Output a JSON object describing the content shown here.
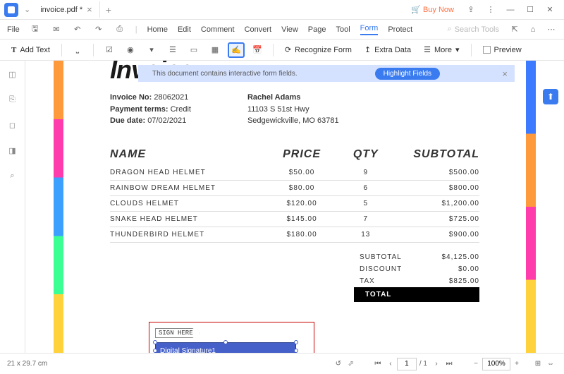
{
  "titlebar": {
    "tab_filename": "invoice.pdf *",
    "buy_now": "Buy Now"
  },
  "menubar": {
    "file": "File",
    "items": [
      "Home",
      "Edit",
      "Comment",
      "Convert",
      "View",
      "Page",
      "Tool",
      "Form",
      "Protect"
    ],
    "search_placeholder": "Search Tools"
  },
  "toolbar": {
    "add_text": "Add Text",
    "recognize_form": "Recognize Form",
    "extra_data": "Extra Data",
    "more": "More",
    "preview": "Preview"
  },
  "banner": {
    "message": "This document contains interactive form fields.",
    "highlight_btn": "Highlight Fields"
  },
  "doc": {
    "title": "Invoice",
    "invoice_no_label": "Invoice No:",
    "invoice_no": "28062021",
    "payment_terms_label": "Payment terms:",
    "payment_terms": "Credit",
    "due_date_label": "Due date:",
    "due_date": "07/02/2021",
    "customer_name": "Rachel Adams",
    "addr1": "11103 S 51st Hwy",
    "addr2": "Sedgewickville, MO 63781",
    "columns": {
      "name": "NAME",
      "price": "PRICE",
      "qty": "QTY",
      "subtotal": "SUBTOTAL"
    },
    "rows": [
      {
        "name": "DRAGON HEAD HELMET",
        "price": "$50.00",
        "qty": "9",
        "subtotal": "$500.00"
      },
      {
        "name": "RAINBOW DREAM HELMET",
        "price": "$80.00",
        "qty": "6",
        "subtotal": "$800.00"
      },
      {
        "name": "CLOUDS HELMET",
        "price": "$120.00",
        "qty": "5",
        "subtotal": "$1,200.00"
      },
      {
        "name": "SNAKE HEAD HELMET",
        "price": "$145.00",
        "qty": "7",
        "subtotal": "$725.00"
      },
      {
        "name": "THUNDERBIRD HELMET",
        "price": "$180.00",
        "qty": "13",
        "subtotal": "$900.00"
      }
    ],
    "totals": {
      "subtotal_label": "SUBTOTAL",
      "subtotal": "$4,125.00",
      "discount_label": "DISCOUNT",
      "discount": "$0.00",
      "tax_label": "TAX",
      "tax": "$825.00",
      "total_label": "TOTAL"
    },
    "sign_here": "SIGN HERE",
    "sig_field_name": "Digital Signature1"
  },
  "statusbar": {
    "dimensions": "21 x 29.7 cm",
    "page_current": "1",
    "page_total": "/ 1",
    "zoom": "100%"
  }
}
